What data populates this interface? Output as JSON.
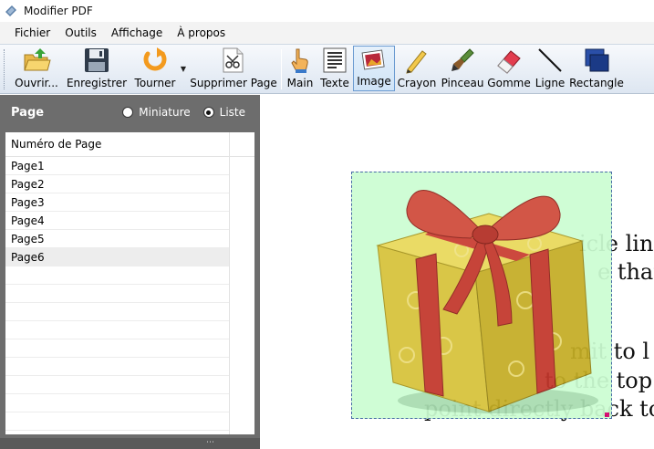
{
  "window": {
    "title": "Modifier PDF"
  },
  "menu": {
    "items": [
      "Fichier",
      "Outils",
      "Affichage",
      "À propos"
    ]
  },
  "toolbar": {
    "tools": [
      {
        "id": "open",
        "label": "Ouvrir...",
        "icon": "open-folder-icon"
      },
      {
        "id": "save",
        "label": "Enregistrer",
        "icon": "floppy-disk-icon"
      },
      {
        "id": "rotate",
        "label": "Tourner",
        "icon": "rotate-icon"
      },
      {
        "id": "delete_page",
        "label": "Supprimer Page",
        "icon": "scissors-page-icon"
      },
      {
        "id": "hand",
        "label": "Main",
        "icon": "hand-pointer-icon"
      },
      {
        "id": "text",
        "label": "Texte",
        "icon": "text-document-icon"
      },
      {
        "id": "image",
        "label": "Image",
        "icon": "image-icon",
        "active": true
      },
      {
        "id": "pencil",
        "label": "Crayon",
        "icon": "pencil-icon"
      },
      {
        "id": "brush",
        "label": "Pinceau",
        "icon": "paint-brush-icon"
      },
      {
        "id": "eraser",
        "label": "Gomme",
        "icon": "eraser-icon"
      },
      {
        "id": "line",
        "label": "Ligne",
        "icon": "line-icon"
      },
      {
        "id": "rectangle",
        "label": "Rectangle",
        "icon": "rectangle-icon"
      }
    ]
  },
  "panel": {
    "title": "Page",
    "view_options": [
      {
        "label": "Miniature",
        "selected": false
      },
      {
        "label": "Liste",
        "selected": true
      }
    ],
    "column_header": "Numéro de Page",
    "pages": [
      "Page1",
      "Page2",
      "Page3",
      "Page4",
      "Page5",
      "Page6"
    ],
    "selected_page": "Page6"
  },
  "document": {
    "text_fragments": [
      "icle link",
      "e that y",
      "mit to l",
      "to the top",
      "point directly back to"
    ]
  },
  "colors": {
    "accent_border": "#6b9bd1",
    "panel_bg": "#6d6d6d",
    "image_bg": "#ccfdd2",
    "selection_handle": "#d4006a"
  }
}
